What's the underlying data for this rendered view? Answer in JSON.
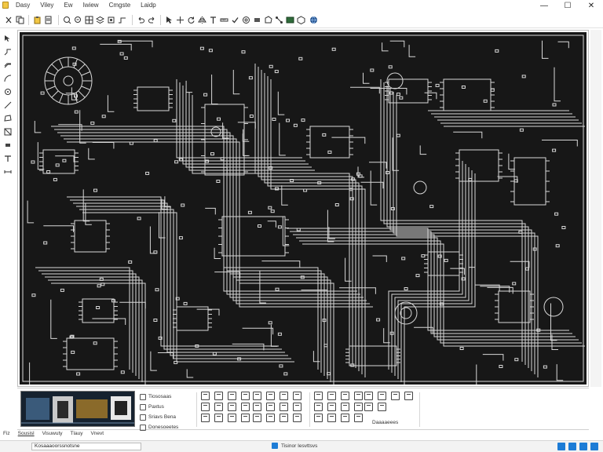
{
  "window": {
    "minimize_glyph": "—",
    "maximize_glyph": "☐",
    "close_glyph": "✕"
  },
  "menu": {
    "items": [
      "Dasy",
      "Viley",
      "Ew",
      "Iwiew",
      "Cmgste",
      "Laidp"
    ]
  },
  "ribbon": {
    "panel_rows": [
      "Tiososaas",
      "Paxtus",
      "Sriavs Bena",
      "Donesoeetes"
    ],
    "section_label": "Daaaaeees"
  },
  "tabs": [
    "Fiz",
    "Sousisl",
    "Visuwuty",
    "Tlauy",
    "Vnevt"
  ],
  "status": {
    "left_field": "Kosaaaoorssnotsne",
    "center_text": "Tisinor Iesvttsvs"
  },
  "colors": {
    "canvas_bg": "#171717",
    "trace": "#d8d8d8",
    "accent": "#1d7cd6"
  }
}
